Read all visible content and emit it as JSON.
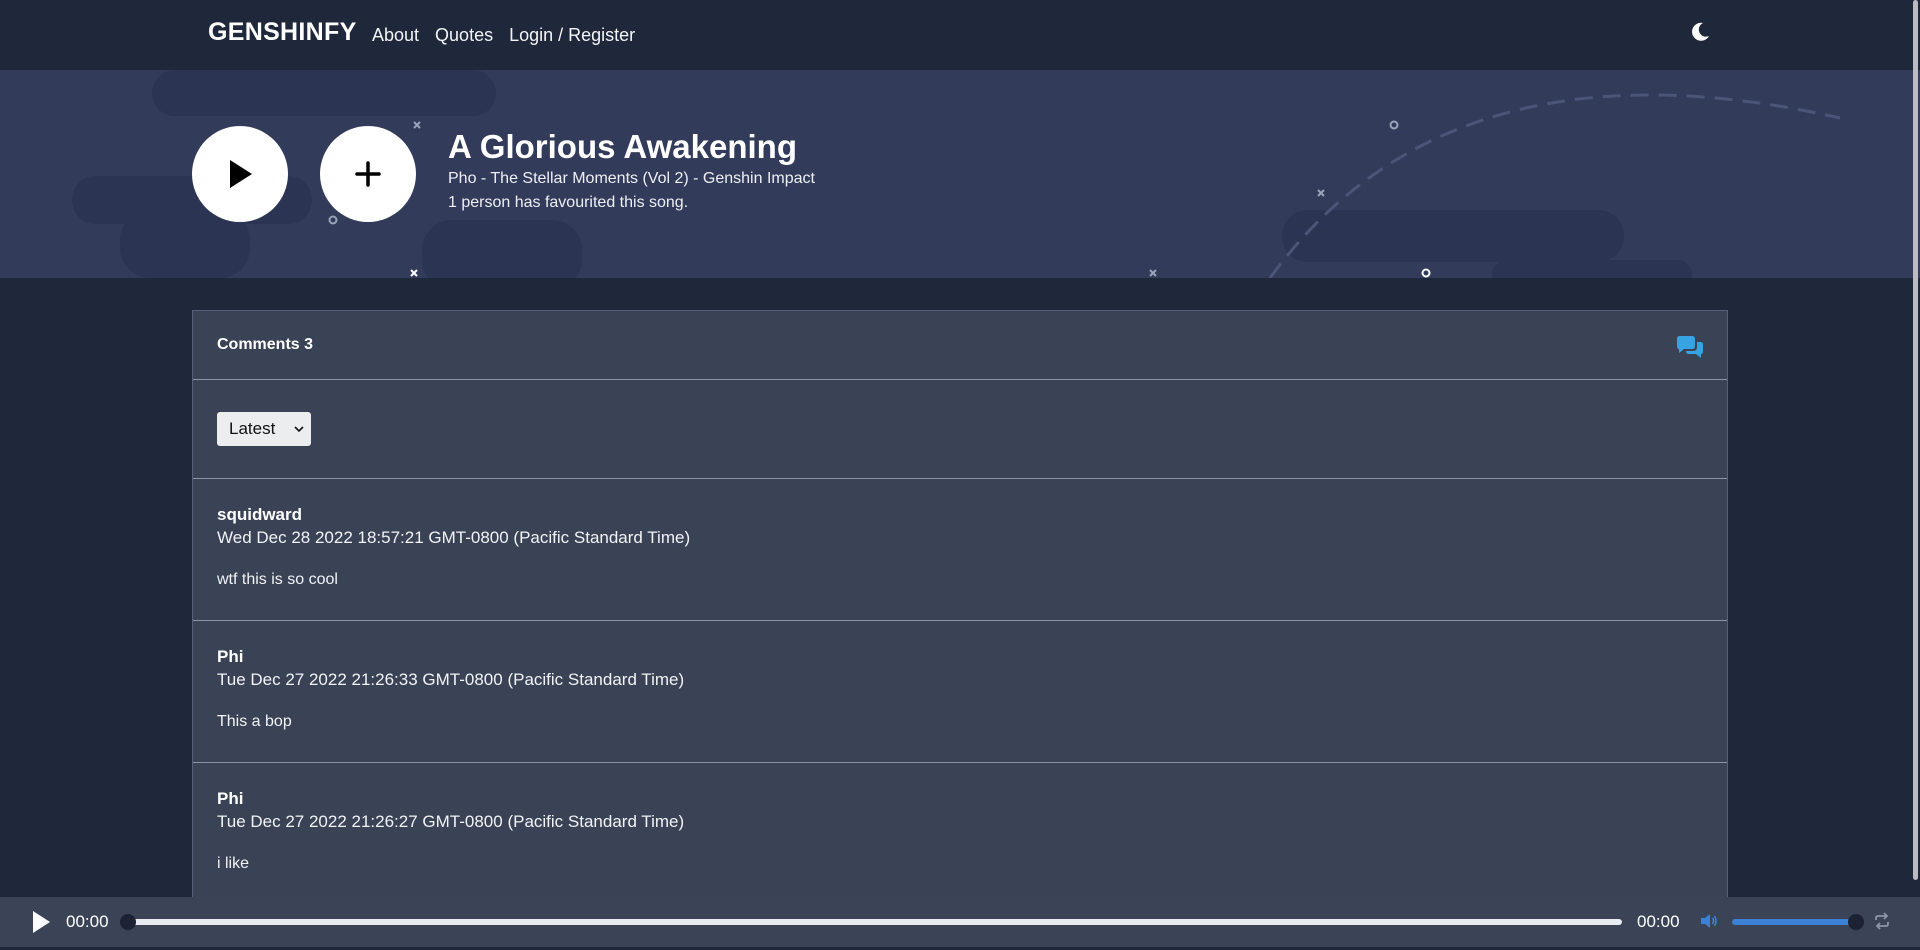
{
  "nav": {
    "brand": "GENSHINFY",
    "links": [
      "About",
      "Quotes",
      "Login / Register"
    ]
  },
  "song": {
    "title": "A Glorious Awakening",
    "subtitle": "Pho - The Stellar Moments (Vol 2) - Genshin Impact",
    "favourites": "1 person has favourited this song."
  },
  "comments": {
    "header": "Comments 3",
    "sort_selected": "Latest",
    "items": [
      {
        "user": "squidward",
        "date": "Wed Dec 28 2022 18:57:21 GMT-0800 (Pacific Standard Time)",
        "text": "wtf this is so cool"
      },
      {
        "user": "Phi",
        "date": "Tue Dec 27 2022 21:26:33 GMT-0800 (Pacific Standard Time)",
        "text": "This a bop"
      },
      {
        "user": "Phi",
        "date": "Tue Dec 27 2022 21:26:27 GMT-0800 (Pacific Standard Time)",
        "text": "i like"
      }
    ]
  },
  "player": {
    "current_time": "00:00",
    "duration": "00:00",
    "progress": 0,
    "volume": 1.0
  },
  "colors": {
    "accent": "#3b82d6",
    "chat_icon": "#36a3e3",
    "hero_bg": "#323b5a",
    "page_bg": "#1e283a",
    "panel_bg": "#394355"
  },
  "icons": {
    "theme": "moon-icon",
    "play": "play-icon",
    "add": "plus-icon",
    "comments": "chat-bubbles-icon",
    "volume": "speaker-icon",
    "loop": "loop-icon"
  }
}
